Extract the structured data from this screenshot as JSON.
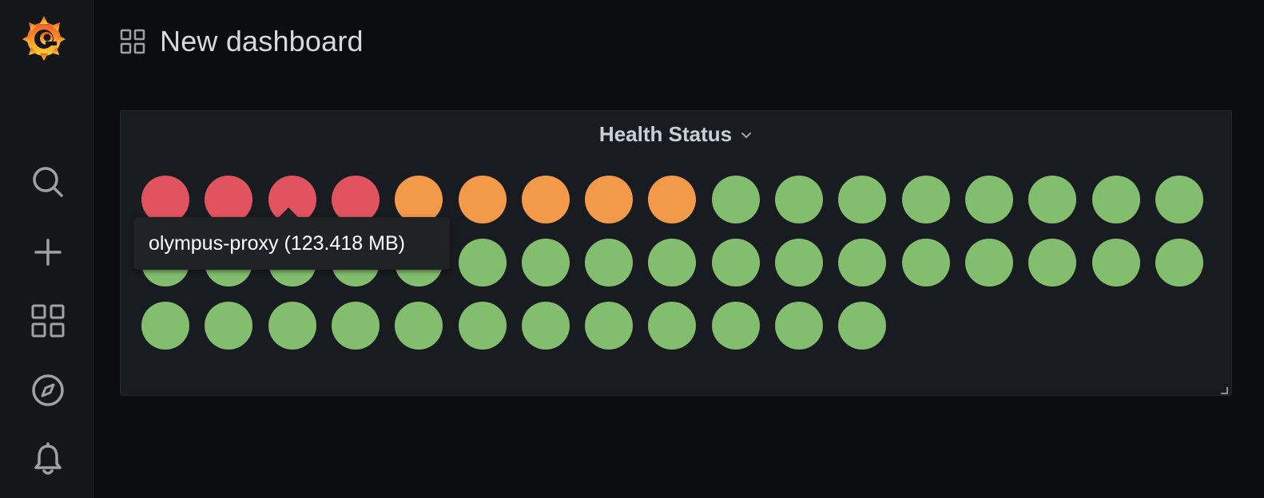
{
  "sidebar": {
    "logo_icon": "grafana-logo-icon",
    "items": [
      {
        "name": "search",
        "icon": "search-icon"
      },
      {
        "name": "create",
        "icon": "plus-icon"
      },
      {
        "name": "dashboards",
        "icon": "dashboards-grid-icon"
      },
      {
        "name": "explore",
        "icon": "compass-icon"
      },
      {
        "name": "alerting",
        "icon": "bell-icon"
      }
    ]
  },
  "header": {
    "title": "New dashboard",
    "icon": "dashboards-grid-icon"
  },
  "panel": {
    "title": "Health Status",
    "menu_icon": "chevron-down-icon",
    "colors": {
      "red": "#e0535f",
      "orange": "#f2994a",
      "green": "#83bd6e"
    },
    "items": [
      "red",
      "red",
      "red",
      "red",
      "orange",
      "orange",
      "orange",
      "orange",
      "orange",
      "green",
      "green",
      "green",
      "green",
      "green",
      "green",
      "green",
      "green",
      "green",
      "green",
      "green",
      "green",
      "green",
      "green",
      "green",
      "green",
      "green",
      "green",
      "green",
      "green",
      "green",
      "green",
      "green",
      "green",
      "green",
      "green",
      "green",
      "green",
      "green",
      "green",
      "green",
      "green",
      "green",
      "green",
      "green",
      "green",
      "green"
    ]
  },
  "tooltip": {
    "text": "olympus-proxy (123.418 MB)"
  },
  "colors": {
    "sidebar_bg": "#141619",
    "page_bg": "#0b0c0e",
    "panel_bg": "#181b1f",
    "text": "#d8d9da"
  }
}
